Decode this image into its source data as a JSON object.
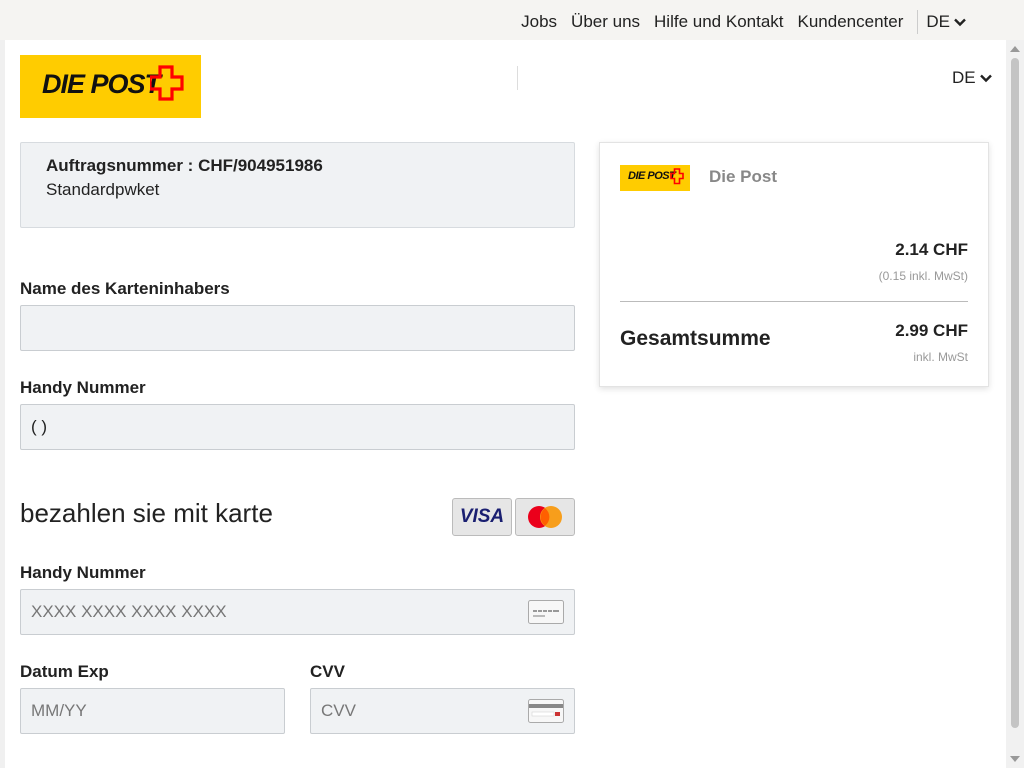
{
  "topnav": {
    "items": [
      "Jobs",
      "Über uns",
      "Hilfe und Kontakt",
      "Kundencenter"
    ],
    "lang": "DE"
  },
  "header": {
    "logo_text": "DIE POST",
    "lang": "DE"
  },
  "order": {
    "number_label": "Auftragsnummer : CHF/904951986",
    "type": "Standardpwket"
  },
  "form": {
    "cardholder_label": "Name des Karteninhabers",
    "cardholder_value": "",
    "phone_label": "Handy Nummer",
    "phone_value": "( )",
    "pay_title": "bezahlen sie mit karte",
    "card_brands": [
      "VISA",
      "mastercard"
    ],
    "card_number_label": "Handy Nummer",
    "card_number_placeholder": "XXXX XXXX XXXX XXXX",
    "exp_label": "Datum Exp",
    "exp_placeholder": "MM/YY",
    "cvv_label": "CVV",
    "cvv_placeholder": "CVV"
  },
  "summary": {
    "logo_text": "DIE POST",
    "merchant": "Die Post",
    "price": "2.14 CHF",
    "price_vat": "(0.15 inkl. MwSt)",
    "total_label": "Gesamtsumme",
    "total_price": "2.99 CHF",
    "total_vat": "inkl. MwSt"
  },
  "colors": {
    "brand_yellow": "#ffcc00",
    "brand_red": "#ff0000",
    "input_bg": "#f0f2f4"
  }
}
